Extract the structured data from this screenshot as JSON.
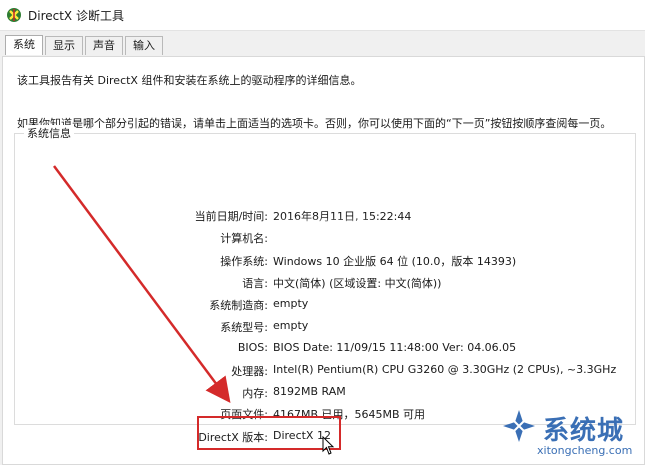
{
  "window": {
    "title": "DirectX 诊断工具",
    "app_icon": "directx-icon"
  },
  "tabs": [
    {
      "label": "系统",
      "active": true
    },
    {
      "label": "显示",
      "active": false
    },
    {
      "label": "声音",
      "active": false
    },
    {
      "label": "输入",
      "active": false
    }
  ],
  "intro": {
    "line1": "该工具报告有关 DirectX 组件和安装在系统上的驱动程序的详细信息。",
    "line2": "如果你知道是哪个部分引起的错误，请单击上面适当的选项卡。否则，你可以使用下面的“下一页”按钮按顺序查阅每一页。"
  },
  "system_info": {
    "group_title": "系统信息",
    "rows": [
      {
        "label": "当前日期/时间:",
        "value": "2016年8月11日, 15:22:44"
      },
      {
        "label": "计算机名:",
        "value": ""
      },
      {
        "label": "操作系统:",
        "value": "Windows 10 企业版 64 位 (10.0，版本 14393)"
      },
      {
        "label": "语言:",
        "value": "中文(简体) (区域设置: 中文(简体))"
      },
      {
        "label": "系统制造商:",
        "value": "empty"
      },
      {
        "label": "系统型号:",
        "value": "empty"
      },
      {
        "label": "BIOS:",
        "value": "BIOS Date: 11/09/15 11:48:00 Ver: 04.06.05"
      },
      {
        "label": "处理器:",
        "value": "Intel(R) Pentium(R) CPU G3260 @ 3.30GHz (2 CPUs), ~3.3GHz"
      },
      {
        "label": "内存:",
        "value": "8192MB RAM"
      },
      {
        "label": "页面文件:",
        "value": "4167MB 已用，5645MB 可用"
      },
      {
        "label": "DirectX 版本:",
        "value": "DirectX 12"
      }
    ]
  },
  "annotation": {
    "highlight_color": "#d42a2a",
    "arrow_color": "#d42a2a"
  },
  "watermark": {
    "brand": "系统城",
    "url": "xitongcheng.com",
    "color": "#3a6fb5"
  }
}
